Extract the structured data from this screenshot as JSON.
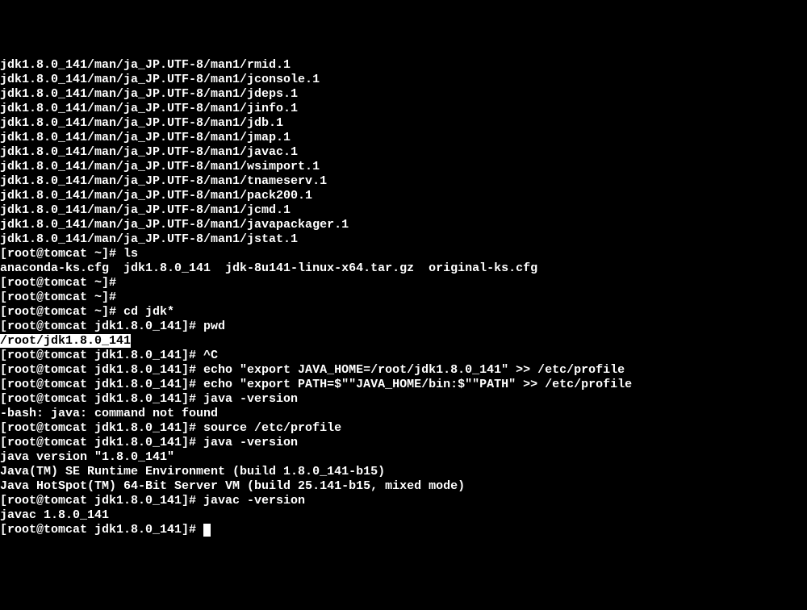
{
  "lines": [
    "jdk1.8.0_141/man/ja_JP.UTF-8/man1/rmid.1",
    "jdk1.8.0_141/man/ja_JP.UTF-8/man1/jconsole.1",
    "jdk1.8.0_141/man/ja_JP.UTF-8/man1/jdeps.1",
    "jdk1.8.0_141/man/ja_JP.UTF-8/man1/jinfo.1",
    "jdk1.8.0_141/man/ja_JP.UTF-8/man1/jdb.1",
    "jdk1.8.0_141/man/ja_JP.UTF-8/man1/jmap.1",
    "jdk1.8.0_141/man/ja_JP.UTF-8/man1/javac.1",
    "jdk1.8.0_141/man/ja_JP.UTF-8/man1/wsimport.1",
    "jdk1.8.0_141/man/ja_JP.UTF-8/man1/tnameserv.1",
    "jdk1.8.0_141/man/ja_JP.UTF-8/man1/pack200.1",
    "jdk1.8.0_141/man/ja_JP.UTF-8/man1/jcmd.1",
    "jdk1.8.0_141/man/ja_JP.UTF-8/man1/javapackager.1",
    "jdk1.8.0_141/man/ja_JP.UTF-8/man1/jstat.1",
    "[root@tomcat ~]# ls",
    "anaconda-ks.cfg  jdk1.8.0_141  jdk-8u141-linux-x64.tar.gz  original-ks.cfg",
    "[root@tomcat ~]#",
    "[root@tomcat ~]#",
    "[root@tomcat ~]# cd jdk*",
    "[root@tomcat jdk1.8.0_141]# pwd"
  ],
  "highlighted_line": "/root/jdk1.8.0_141",
  "lines_after": [
    "[root@tomcat jdk1.8.0_141]# ^C",
    "[root@tomcat jdk1.8.0_141]# echo \"export JAVA_HOME=/root/jdk1.8.0_141\" >> /etc/profile",
    "[root@tomcat jdk1.8.0_141]# echo \"export PATH=$\"\"JAVA_HOME/bin:$\"\"PATH\" >> /etc/profile",
    "[root@tomcat jdk1.8.0_141]# java -version",
    "-bash: java: command not found",
    "[root@tomcat jdk1.8.0_141]# source /etc/profile",
    "[root@tomcat jdk1.8.0_141]# java -version",
    "java version \"1.8.0_141\"",
    "Java(TM) SE Runtime Environment (build 1.8.0_141-b15)",
    "Java HotSpot(TM) 64-Bit Server VM (build 25.141-b15, mixed mode)",
    "[root@tomcat jdk1.8.0_141]# javac -version",
    "javac 1.8.0_141"
  ],
  "final_prompt": "[root@tomcat jdk1.8.0_141]# "
}
